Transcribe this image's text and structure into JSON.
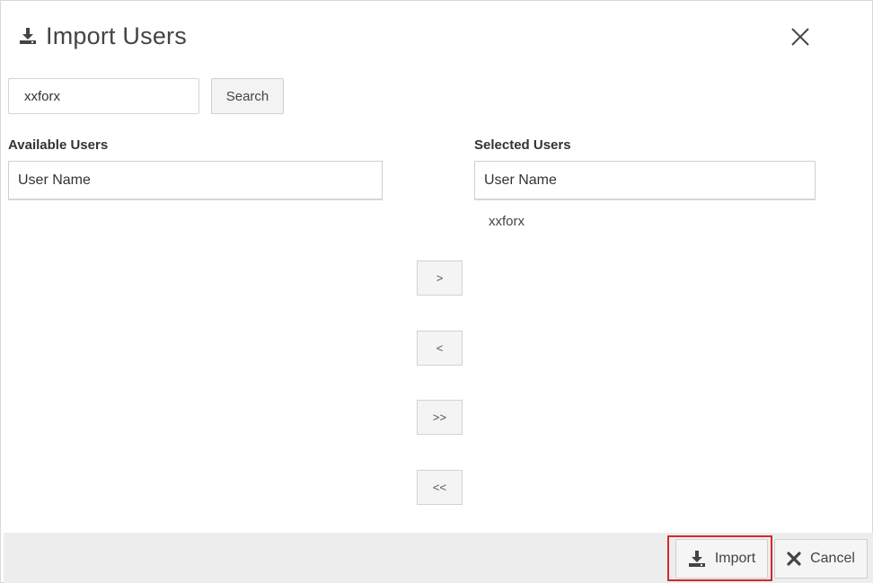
{
  "dialog": {
    "title": "Import Users",
    "title_icon": "import-icon",
    "close_icon": "close-icon"
  },
  "search": {
    "value": "xxforx",
    "button_label": "Search"
  },
  "available": {
    "label": "Available Users",
    "column_header": "User Name",
    "items": []
  },
  "selected": {
    "label": "Selected Users",
    "column_header": "User Name",
    "items": [
      "xxforx"
    ]
  },
  "transfer_buttons": {
    "move_right": ">",
    "move_left": "<",
    "move_all_right": ">>",
    "move_all_left": "<<"
  },
  "footer": {
    "import_label": "Import",
    "import_icon": "import-icon",
    "cancel_label": "Cancel",
    "cancel_icon": "x-icon"
  },
  "colors": {
    "highlight": "#d42a2a",
    "footer_bg": "#ededed",
    "button_bg": "#f4f4f4"
  }
}
